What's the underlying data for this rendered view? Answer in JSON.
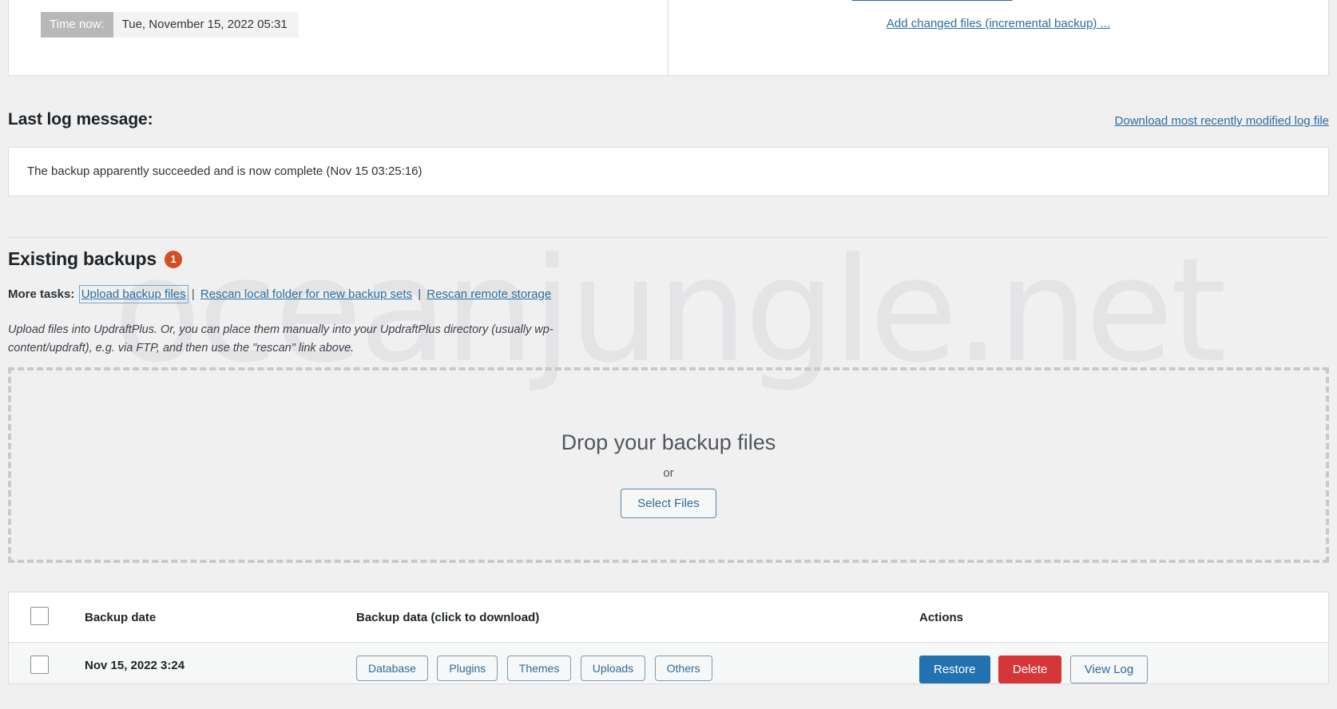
{
  "top_panel": {
    "time_now_label": "Time now:",
    "time_now_value": "Tue, November 15, 2022 05:31",
    "incremental_link": "Add changed files (incremental backup) ..."
  },
  "last_log": {
    "heading": "Last log message:",
    "download_link": "Download most recently modified log file",
    "message": "The backup apparently succeeded and is now complete (Nov 15 03:25:16)"
  },
  "existing_backups": {
    "heading": "Existing backups",
    "count": "1",
    "more_tasks_label": "More tasks:",
    "task_upload": "Upload backup files",
    "task_rescan_local": "Rescan local folder for new backup sets",
    "task_rescan_remote": "Rescan remote storage",
    "separator": "|",
    "description_line1": "Upload files into UpdraftPlus. Or, you can place them manually into your UpdraftPlus directory (usually wp-",
    "description_line2": "content/updraft), e.g. via FTP, and then use the \"rescan\" link above."
  },
  "dropzone": {
    "title": "Drop your backup files",
    "or": "or",
    "select_files_button": "Select Files"
  },
  "table": {
    "headers": {
      "checkbox": "",
      "backup_date": "Backup date",
      "backup_data": "Backup data (click to download)",
      "actions": "Actions"
    },
    "rows": [
      {
        "date": "Nov 15, 2022 3:24",
        "data_chips": [
          "Database",
          "Plugins",
          "Themes",
          "Uploads",
          "Others"
        ],
        "actions": [
          "Restore",
          "Delete",
          "View Log"
        ]
      }
    ]
  },
  "watermark": {
    "text": "oceanjungle.net"
  },
  "colors": {
    "accent_blue": "#2271b1",
    "link_blue": "#2c6d9e",
    "badge_orange": "#d54e21",
    "delete_red": "#d63638",
    "page_bg": "#f0f0f1"
  }
}
